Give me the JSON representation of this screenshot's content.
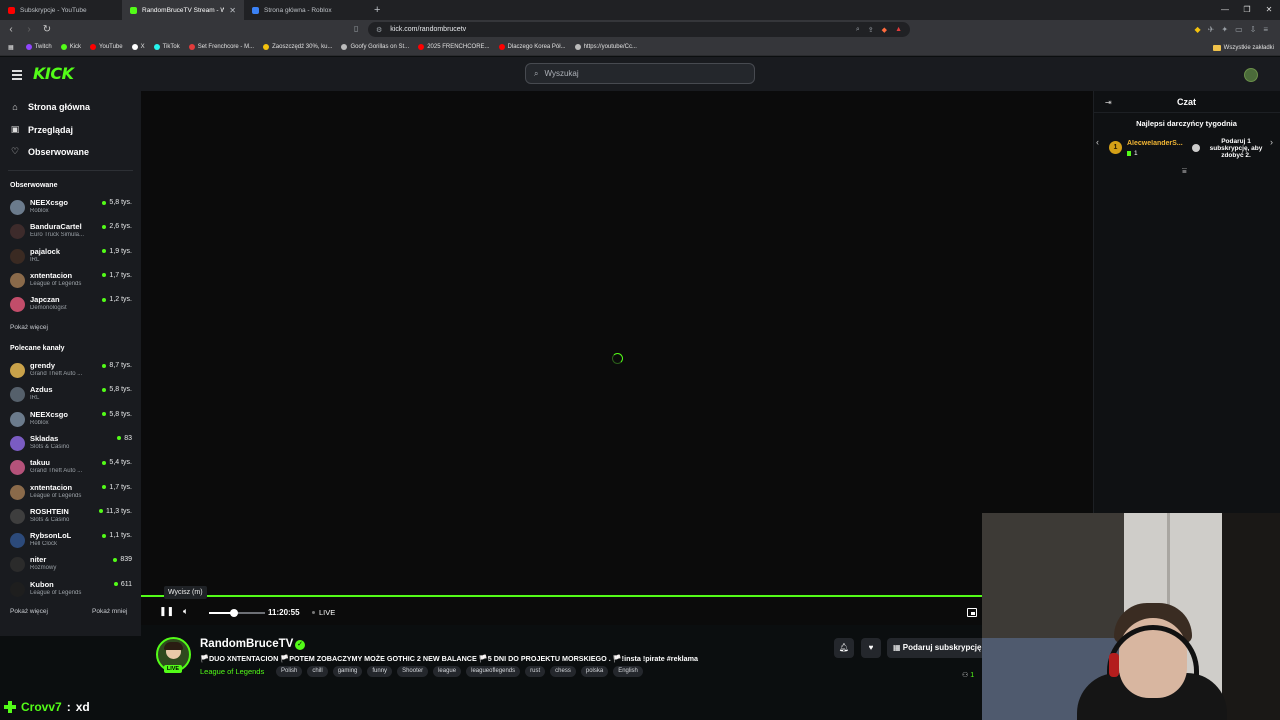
{
  "browser": {
    "tabs": [
      {
        "title": "Subskrypcje - YouTube",
        "icon": "youtube-icon",
        "color": "#ff0000",
        "active": false
      },
      {
        "title": "RandomBruceTV Stream - W",
        "icon": "kick-icon",
        "color": "#53fc18",
        "active": true
      },
      {
        "title": "Strona główna - Roblox",
        "icon": "roblox-icon",
        "color": "#3b82f6",
        "active": false
      }
    ],
    "new_tab": "+",
    "url": "kick.com/randombrucetv",
    "bookmarks": [
      {
        "label": "Twitch",
        "color": "#9146ff"
      },
      {
        "label": "Kick",
        "color": "#53fc18"
      },
      {
        "label": "YouTube",
        "color": "#ff0000"
      },
      {
        "label": "X",
        "color": "#ffffff"
      },
      {
        "label": "TikTok",
        "color": "#25f4ee"
      },
      {
        "label": "Set Frenchcore - M...",
        "color": "#e23b3b"
      },
      {
        "label": "Zaoszczędź 30%, ku...",
        "color": "#f4c20d"
      },
      {
        "label": "Goofy Gorillas on St...",
        "color": "#bbbbbb"
      },
      {
        "label": "2025 FRENCHCORE...",
        "color": "#ff0000"
      },
      {
        "label": "Dlaczego Korea Pół...",
        "color": "#ff0000"
      },
      {
        "label": "https://youtube/Cc...",
        "color": "#bbbbbb"
      }
    ],
    "all_bookmarks": "Wszystkie zakładki"
  },
  "header": {
    "logo": "KICK",
    "search_placeholder": "Wyszukaj"
  },
  "sidebar": {
    "nav": [
      {
        "label": "Strona główna",
        "icon": "home-icon"
      },
      {
        "label": "Przeglądaj",
        "icon": "browse-icon"
      },
      {
        "label": "Obserwowane",
        "icon": "heart-icon"
      }
    ],
    "followed_title": "Obserwowane",
    "followed": [
      {
        "name": "NEEXcsgo",
        "category": "Roblox",
        "viewers": "5,8 tys.",
        "color": "#6b7b8c"
      },
      {
        "name": "BanduraCartel",
        "category": "Euro Truck Simula...",
        "viewers": "2,6 tys.",
        "color": "#3d2b2b"
      },
      {
        "name": "pajalock",
        "category": "IRL",
        "viewers": "1,9 tys.",
        "color": "#3a2a22"
      },
      {
        "name": "xntentacion",
        "category": "League of Legends",
        "viewers": "1,7 tys.",
        "color": "#8a6a4a"
      },
      {
        "name": "Japczan",
        "category": "Demonologist",
        "viewers": "1,2 tys.",
        "color": "#c24d6a"
      }
    ],
    "show_more": "Pokaż więcej",
    "recommended_title": "Polecane kanały",
    "recommended": [
      {
        "name": "grendy",
        "category": "Grand Theft Auto ...",
        "viewers": "8,7 tys.",
        "color": "#c9a24a"
      },
      {
        "name": "Azdus",
        "category": "IRL",
        "viewers": "5,8 tys.",
        "color": "#55606b"
      },
      {
        "name": "NEEXcsgo",
        "category": "Roblox",
        "viewers": "5,8 tys.",
        "color": "#6b7b8c"
      },
      {
        "name": "Skladas",
        "category": "Slots & Casino",
        "viewers": "83",
        "color": "#7a5cc2"
      },
      {
        "name": "takuu",
        "category": "Grand Theft Auto ...",
        "viewers": "5,4 tys.",
        "color": "#b5527a"
      },
      {
        "name": "xntentacion",
        "category": "League of Legends",
        "viewers": "1,7 tys.",
        "color": "#8a6a4a"
      },
      {
        "name": "ROSHTEIN",
        "category": "Slots & Casino",
        "viewers": "11,3 tys.",
        "color": "#3e3e3e"
      },
      {
        "name": "RybsonLoL",
        "category": "Hell Clock",
        "viewers": "1,1 tys.",
        "color": "#2c4a7a"
      },
      {
        "name": "niter",
        "category": "Rozmowy",
        "viewers": "839",
        "color": "#2b2b2b"
      },
      {
        "name": "Kubon",
        "category": "League of Legends",
        "viewers": "611",
        "color": "#1e1e1e"
      }
    ],
    "show_more_2": "Pokaż więcej",
    "show_less": "Pokaż mniej"
  },
  "player": {
    "tooltip": "Wycisz (m)",
    "time": "11:20:55",
    "live_label": "LIVE",
    "volume": 0.45
  },
  "stream": {
    "channel": "RandomBruceTV",
    "live_badge": "LIVE",
    "title": "🏳️DUO XNTENTACION 🏳️POTEM ZOBACZYMY MOŻE GOTHIC 2 NEW BALANCE 🏳️5 DNI DO PROJEKTU MORSKIEGO . 🏳️!insta !pirate #reklama",
    "category": "League of Legends",
    "tags": [
      "Polish",
      "chill",
      "gaming",
      "funny",
      "Shooter",
      "league",
      "leagueoflegends",
      "rust",
      "chess",
      "polska",
      "English"
    ],
    "gift_button": "Podaruj subskrypcję",
    "viewers_partial": "1"
  },
  "chat": {
    "title": "Czat",
    "top_gifters_title": "Najlepsi darczyńcy tygodnia",
    "gifter": {
      "rank": "1",
      "name": "AlecwelanderS...",
      "count": "1"
    },
    "gift_cta": "Podaruj 1 subskrypcję, aby zdobyć 2."
  },
  "overlay_chat": {
    "user": "Crovv7",
    "separator": ":",
    "message": "xd"
  }
}
